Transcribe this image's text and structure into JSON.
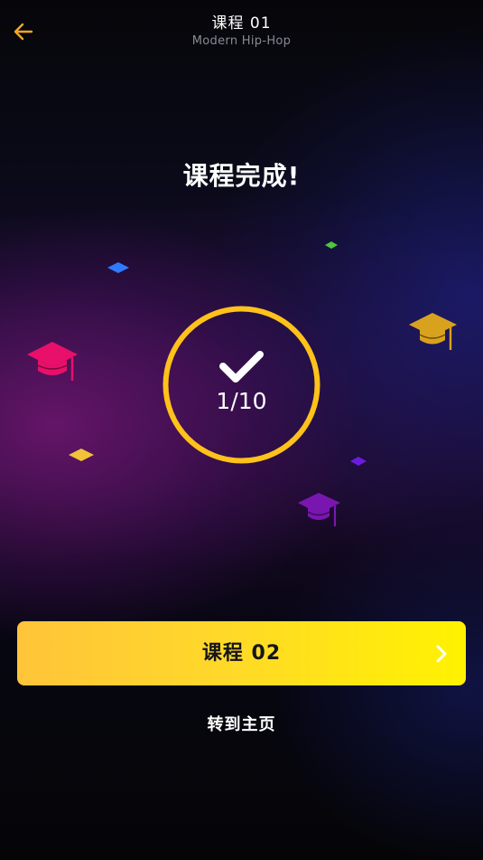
{
  "header": {
    "title": "课程 01",
    "subtitle": "Modern Hip-Hop",
    "back_icon": "arrow-left-icon"
  },
  "main": {
    "headline": "课程完成!",
    "progress_text": "1/10",
    "progress_fraction": 0.1,
    "check_icon": "checkmark-icon"
  },
  "actions": {
    "next_lesson_label": "课程 02",
    "next_icon": "chevron-right-icon",
    "home_link_label": "转到主页"
  },
  "colors": {
    "accent": "#F5A623",
    "ring": "#FFC21A",
    "button_start": "#FFC43A",
    "button_end": "#FFF200",
    "cap_pink": "#E8106A",
    "cap_gold": "#D9A21E",
    "cap_purple": "#7A16B0",
    "confetti_blue": "#2F7BFF",
    "confetti_green": "#4CC93A",
    "confetti_yellow": "#F2C23A",
    "confetti_violet": "#6B1BE0"
  }
}
